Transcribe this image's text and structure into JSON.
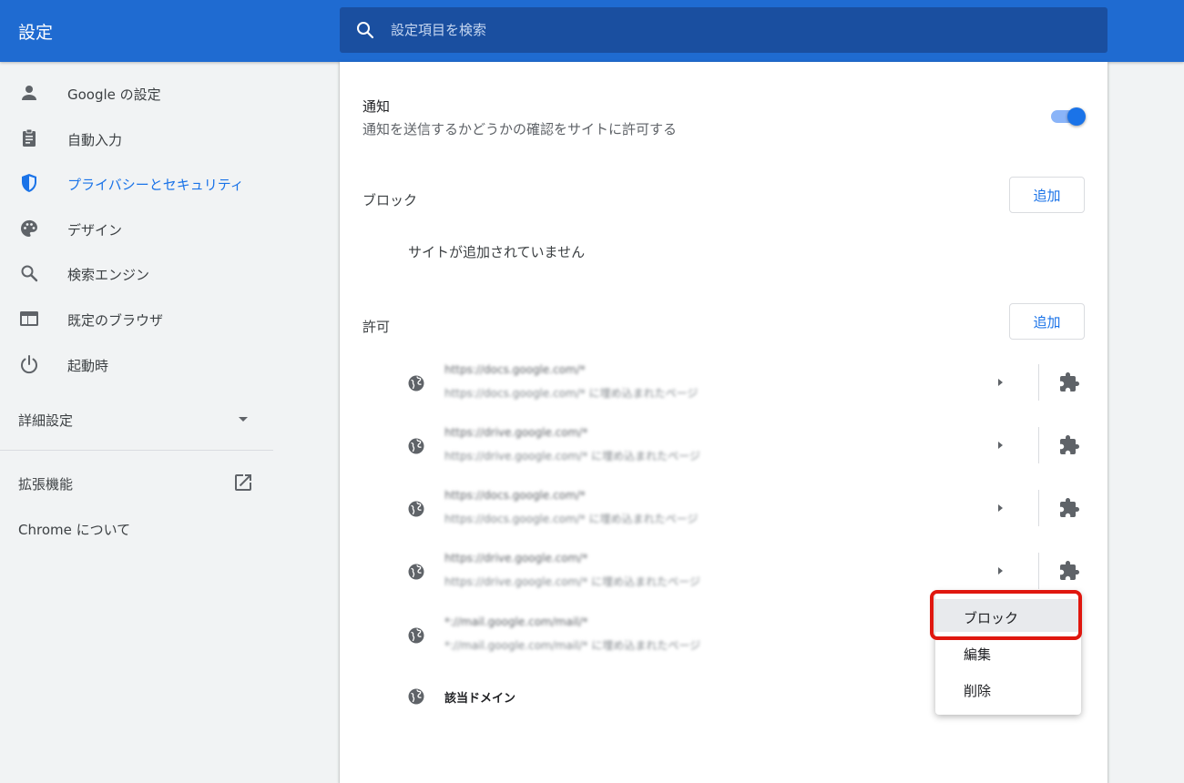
{
  "header": {
    "title": "設定",
    "search_placeholder": "設定項目を検索"
  },
  "sidebar": {
    "items": [
      {
        "label": "Google の設定",
        "icon": "person-icon"
      },
      {
        "label": "自動入力",
        "icon": "clipboard-icon"
      },
      {
        "label": "プライバシーとセキュリティ",
        "icon": "shield-icon",
        "active": true
      },
      {
        "label": "デザイン",
        "icon": "palette-icon"
      },
      {
        "label": "検索エンジン",
        "icon": "search-icon"
      },
      {
        "label": "既定のブラウザ",
        "icon": "browser-window-icon"
      },
      {
        "label": "起動時",
        "icon": "power-icon"
      }
    ],
    "advanced_label": "詳細設定",
    "extensions_label": "拡張機能",
    "about_label": "Chrome について"
  },
  "notifications": {
    "title": "通知",
    "description": "通知を送信するかどうかの確認をサイトに許可する",
    "enabled": true
  },
  "block_section": {
    "title": "ブロック",
    "add_label": "追加",
    "empty_message": "サイトが追加されていません"
  },
  "allow_section": {
    "title": "許可",
    "add_label": "追加",
    "sites": [
      {
        "url": "https://docs.google.com/*",
        "sub": "https://docs.google.com/* に埋め込まれたページ"
      },
      {
        "url": "https://drive.google.com/*",
        "sub": "https://drive.google.com/* に埋め込まれたページ"
      },
      {
        "url": "https://docs.google.com/*",
        "sub": "https://docs.google.com/* に埋め込まれたページ"
      },
      {
        "url": "https://drive.google.com/*",
        "sub": "https://drive.google.com/* に埋め込まれたページ"
      },
      {
        "url": "*://mail.google.com/mail/*",
        "sub": "*://mail.google.com/mail/* に埋め込まれたページ"
      }
    ],
    "domain_label": "該当ドメイン"
  },
  "context_menu": {
    "items": [
      "ブロック",
      "編集",
      "削除"
    ],
    "highlighted": "ブロック",
    "highlight_color": "#e0170f"
  },
  "colors": {
    "header_bg": "#1f6bd1",
    "search_bg": "#1a4fa0",
    "accent": "#1a73e8"
  }
}
